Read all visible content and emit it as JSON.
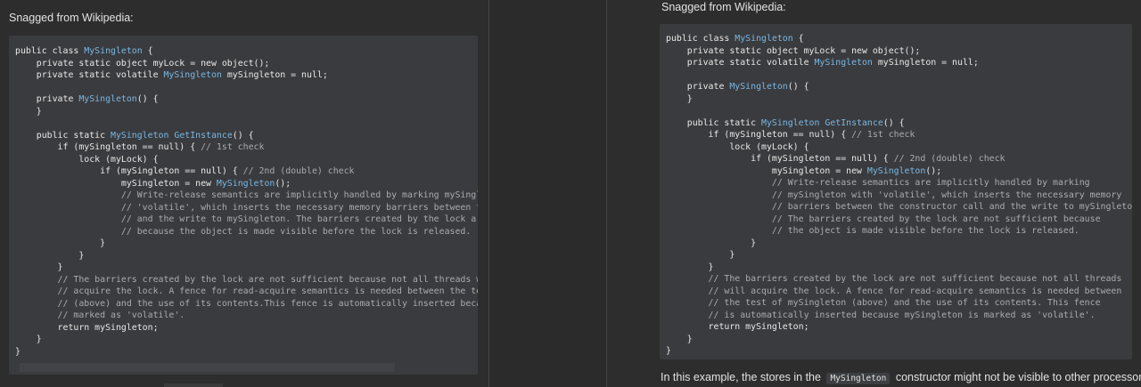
{
  "left": {
    "caption": "Snagged from Wikipedia:",
    "code_lines": [
      [
        {
          "t": "public class "
        },
        {
          "t": "MySingleton",
          "c": "type"
        },
        {
          "t": " {"
        }
      ],
      [
        {
          "t": "    private static object myLock = new object();"
        }
      ],
      [
        {
          "t": "    private static volatile "
        },
        {
          "t": "MySingleton",
          "c": "type"
        },
        {
          "t": " mySingleton = null;"
        }
      ],
      [],
      [
        {
          "t": "    private "
        },
        {
          "t": "MySingleton",
          "c": "type"
        },
        {
          "t": "() {"
        }
      ],
      [
        {
          "t": "    }"
        }
      ],
      [],
      [
        {
          "t": "    public static "
        },
        {
          "t": "MySingleton",
          "c": "type"
        },
        {
          "t": " "
        },
        {
          "t": "GetInstance",
          "c": "type"
        },
        {
          "t": "() {"
        }
      ],
      [
        {
          "t": "        if (mySingleton == null) { "
        },
        {
          "t": "// 1st check",
          "c": "comment"
        }
      ],
      [
        {
          "t": "            lock (myLock) {"
        }
      ],
      [
        {
          "t": "                if (mySingleton == null) { "
        },
        {
          "t": "// 2nd (double) check",
          "c": "comment"
        }
      ],
      [
        {
          "t": "                    mySingleton = new "
        },
        {
          "t": "MySingleton",
          "c": "type"
        },
        {
          "t": "();"
        }
      ],
      [
        {
          "t": "                    // Write-release semantics are implicitly handled by marking mySingleton with",
          "c": "comment"
        }
      ],
      [
        {
          "t": "                    // 'volatile', which inserts the necessary memory barriers between the constructor call",
          "c": "comment"
        }
      ],
      [
        {
          "t": "                    // and the write to mySingleton. The barriers created by the lock are not sufficient",
          "c": "comment"
        }
      ],
      [
        {
          "t": "                    // because the object is made visible before the lock is released.",
          "c": "comment"
        }
      ],
      [
        {
          "t": "                }"
        }
      ],
      [
        {
          "t": "            }"
        }
      ],
      [
        {
          "t": "        }"
        }
      ],
      [
        {
          "t": "        // The barriers created by the lock are not sufficient because not all threads will",
          "c": "comment"
        }
      ],
      [
        {
          "t": "        // acquire the lock. A fence for read-acquire semantics is needed between the test of mySingleton",
          "c": "comment"
        }
      ],
      [
        {
          "t": "        // (above) and the use of its contents.This fence is automatically inserted because mySingleton is",
          "c": "comment"
        }
      ],
      [
        {
          "t": "        // marked as 'volatile'.",
          "c": "comment"
        }
      ],
      [
        {
          "t": "        return mySingleton;"
        }
      ],
      [
        {
          "t": "    }"
        }
      ],
      [
        {
          "t": "}"
        }
      ]
    ]
  },
  "right": {
    "caption": "Snagged from Wikipedia:",
    "code_lines": [
      [
        {
          "t": "public class "
        },
        {
          "t": "MySingleton",
          "c": "type"
        },
        {
          "t": " {"
        }
      ],
      [
        {
          "t": "    private static object myLock = new object();"
        }
      ],
      [
        {
          "t": "    private static volatile "
        },
        {
          "t": "MySingleton",
          "c": "type"
        },
        {
          "t": " mySingleton = null;"
        }
      ],
      [],
      [
        {
          "t": "    private "
        },
        {
          "t": "MySingleton",
          "c": "type"
        },
        {
          "t": "() {"
        }
      ],
      [
        {
          "t": "    }"
        }
      ],
      [],
      [
        {
          "t": "    public static "
        },
        {
          "t": "MySingleton",
          "c": "type"
        },
        {
          "t": " "
        },
        {
          "t": "GetInstance",
          "c": "type"
        },
        {
          "t": "() {"
        }
      ],
      [
        {
          "t": "        if (mySingleton == null) { "
        },
        {
          "t": "// 1st check",
          "c": "comment"
        }
      ],
      [
        {
          "t": "            lock (myLock) {"
        }
      ],
      [
        {
          "t": "                if (mySingleton == null) { "
        },
        {
          "t": "// 2nd (double) check",
          "c": "comment"
        }
      ],
      [
        {
          "t": "                    mySingleton = new "
        },
        {
          "t": "MySingleton",
          "c": "type"
        },
        {
          "t": "();"
        }
      ],
      [
        {
          "t": "                    // Write-release semantics are implicitly handled by marking",
          "c": "comment"
        }
      ],
      [
        {
          "t": "                    // mySingleton with 'volatile', which inserts the necessary memory",
          "c": "comment"
        }
      ],
      [
        {
          "t": "                    // barriers between the constructor call and the write to mySingleton.",
          "c": "comment"
        }
      ],
      [
        {
          "t": "                    // The barriers created by the lock are not sufficient because",
          "c": "comment"
        }
      ],
      [
        {
          "t": "                    // the object is made visible before the lock is released.",
          "c": "comment"
        }
      ],
      [
        {
          "t": "                }"
        }
      ],
      [
        {
          "t": "            }"
        }
      ],
      [
        {
          "t": "        }"
        }
      ],
      [
        {
          "t": "        // The barriers created by the lock are not sufficient because not all threads",
          "c": "comment"
        }
      ],
      [
        {
          "t": "        // will acquire the lock. A fence for read-acquire semantics is needed between",
          "c": "comment"
        }
      ],
      [
        {
          "t": "        // the test of mySingleton (above) and the use of its contents. This fence",
          "c": "comment"
        }
      ],
      [
        {
          "t": "        // is automatically inserted because mySingleton is marked as 'volatile'.",
          "c": "comment"
        }
      ],
      [
        {
          "t": "        return mySingleton;"
        }
      ],
      [
        {
          "t": "    }"
        }
      ],
      [
        {
          "t": "}"
        }
      ]
    ],
    "paragraph": {
      "before": "In this example, the stores in the",
      "code": "MySingleton",
      "after": "constructor might not be visible to other processors"
    }
  },
  "colors": {
    "background": "#2d2d2d",
    "code_background": "#3a3b3e",
    "type_highlight": "#79b7e4",
    "comment": "#a9abae",
    "text": "#e2e2e2"
  }
}
